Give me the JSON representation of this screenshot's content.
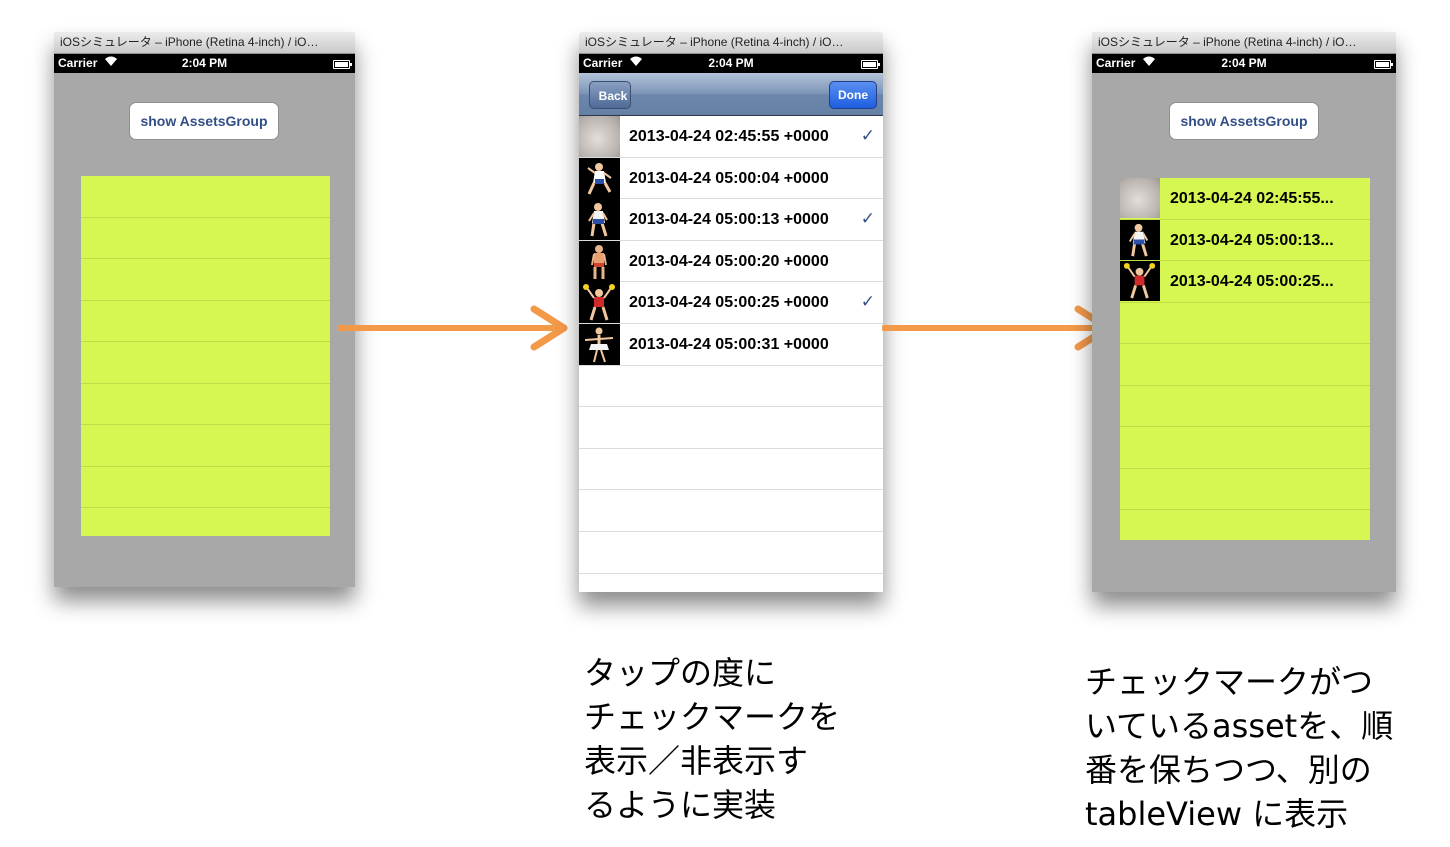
{
  "simulator": {
    "window_title": "iOSシミュレータ – iPhone (Retina 4-inch) / iO…",
    "carrier": "Carrier",
    "time": "2:04 PM"
  },
  "screen1": {
    "show_button_label": "show AssetsGroup"
  },
  "screen2": {
    "back_label": "Back",
    "done_label": "Done",
    "rows": [
      {
        "label": "2013-04-24 02:45:55 +0000",
        "checked": true,
        "thumb": "photo"
      },
      {
        "label": "2013-04-24 05:00:04 +0000",
        "checked": false,
        "thumb": "figure"
      },
      {
        "label": "2013-04-24 05:00:13 +0000",
        "checked": true,
        "thumb": "figure"
      },
      {
        "label": "2013-04-24 05:00:20 +0000",
        "checked": false,
        "thumb": "figure"
      },
      {
        "label": "2013-04-24 05:00:25 +0000",
        "checked": true,
        "thumb": "figure"
      },
      {
        "label": "2013-04-24 05:00:31 +0000",
        "checked": false,
        "thumb": "figure"
      }
    ],
    "checkmark": "✓"
  },
  "screen3": {
    "show_button_label": "show AssetsGroup",
    "rows": [
      {
        "label": "2013-04-24 02:45:55...",
        "thumb": "photo"
      },
      {
        "label": "2013-04-24 05:00:13...",
        "thumb": "figure"
      },
      {
        "label": "2013-04-24 05:00:25...",
        "thumb": "figure"
      }
    ]
  },
  "captions": {
    "middle": [
      "タップの度に",
      "チェックマークを",
      "表示／非表示す",
      "るように実装"
    ],
    "right": [
      "チェックマークがつ",
      "いているassetを、順",
      "番を保ちつつ、別の",
      "tableView に表示"
    ]
  },
  "colors": {
    "table_yellow": "#d6f752",
    "arrow_orange": "#f39a4a",
    "simulator_gray": "#a8a8a8",
    "checkmark_blue": "#324f85"
  },
  "icons": [
    "wifi-icon",
    "battery-icon",
    "checkmark-icon",
    "arrow-right-icon"
  ]
}
